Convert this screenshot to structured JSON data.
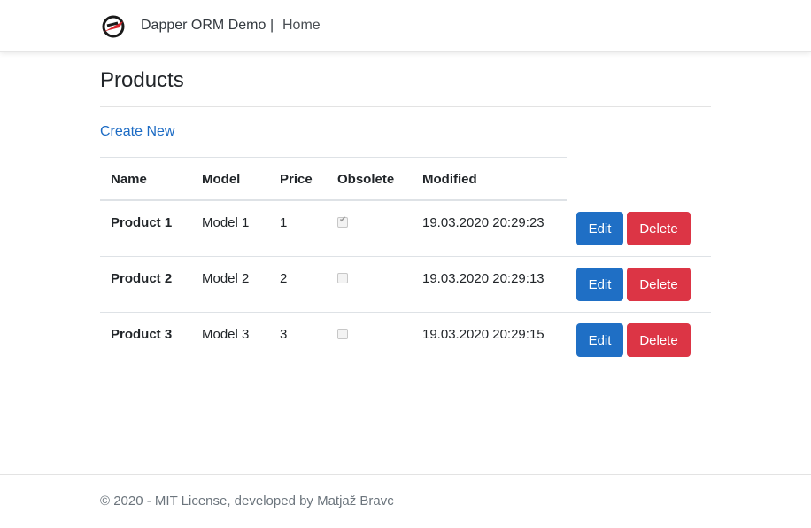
{
  "navbar": {
    "logo_icon": "dapper-logo-icon",
    "brand": "Dapper ORM Demo",
    "separator": "|",
    "home": "Home"
  },
  "page": {
    "title": "Products",
    "create_new": "Create New"
  },
  "table": {
    "columns": [
      "Name",
      "Model",
      "Price",
      "Obsolete",
      "Modified"
    ],
    "rows": [
      {
        "name": "Product 1",
        "model": "Model 1",
        "price": "1",
        "obsolete": true,
        "modified": "19.03.2020 20:29:23",
        "edit": "Edit",
        "delete": "Delete"
      },
      {
        "name": "Product 2",
        "model": "Model 2",
        "price": "2",
        "obsolete": false,
        "modified": "19.03.2020 20:29:13",
        "edit": "Edit",
        "delete": "Delete"
      },
      {
        "name": "Product 3",
        "model": "Model 3",
        "price": "3",
        "obsolete": false,
        "modified": "19.03.2020 20:29:15",
        "edit": "Edit",
        "delete": "Delete"
      }
    ]
  },
  "footer": {
    "text": "© 2020 - MIT License, developed by Matjaž Bravc"
  },
  "colors": {
    "link": "#1c6bc4",
    "edit_button": "#1f6fc5",
    "delete_button": "#dc3545"
  }
}
